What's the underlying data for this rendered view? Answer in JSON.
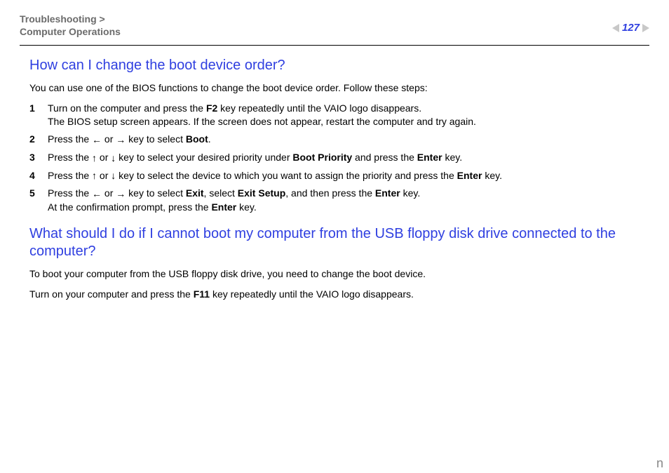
{
  "header": {
    "breadcrumb_top": "Troubleshooting >",
    "breadcrumb_bottom": "Computer Operations",
    "page_number": "127",
    "footer_letter": "n"
  },
  "section1": {
    "heading": "How can I change the boot device order?",
    "intro": "You can use one of the BIOS functions to change the boot device order. Follow these steps:",
    "steps": [
      {
        "num": "1",
        "pre": "Turn on the computer and press the ",
        "key": "F2",
        "post": " key repeatedly until the VAIO logo disappears.",
        "line2": "The BIOS setup screen appears. If the screen does not appear, restart the computer and try again."
      },
      {
        "num": "2",
        "pre": "Press the ",
        "arrow1": "←",
        "mid": " or ",
        "arrow2": "→",
        "post": " key to select ",
        "bold1": "Boot",
        "tail": "."
      },
      {
        "num": "3",
        "pre": "Press the ",
        "arrow1": "↑",
        "mid": " or ",
        "arrow2": "↓",
        "post": " key to select your desired priority under ",
        "bold1": "Boot Priority",
        "tail1": " and press the ",
        "bold2": "Enter",
        "tail": " key."
      },
      {
        "num": "4",
        "pre": "Press the ",
        "arrow1": "↑",
        "mid": " or ",
        "arrow2": "↓",
        "post": " key to select the device to which you want to assign the priority and press the ",
        "bold1": "Enter",
        "tail": " key."
      },
      {
        "num": "5",
        "pre": "Press the ",
        "arrow1": "←",
        "mid": " or ",
        "arrow2": "→",
        "post": " key to select ",
        "bold1": "Exit",
        "tail1": ", select ",
        "bold2": "Exit Setup",
        "tail2": ", and then press the ",
        "bold3": "Enter",
        "tail3": " key.",
        "line2a": "At the confirmation prompt, press the ",
        "line2b": "Enter",
        "line2c": " key."
      }
    ]
  },
  "section2": {
    "heading": "What should I do if I cannot boot my computer from the USB floppy disk drive connected to the computer?",
    "p1": "To boot your computer from the USB floppy disk drive, you need to change the boot device.",
    "p2a": "Turn on your computer and press the ",
    "p2b": "F11",
    "p2c": " key repeatedly until the VAIO logo disappears."
  }
}
